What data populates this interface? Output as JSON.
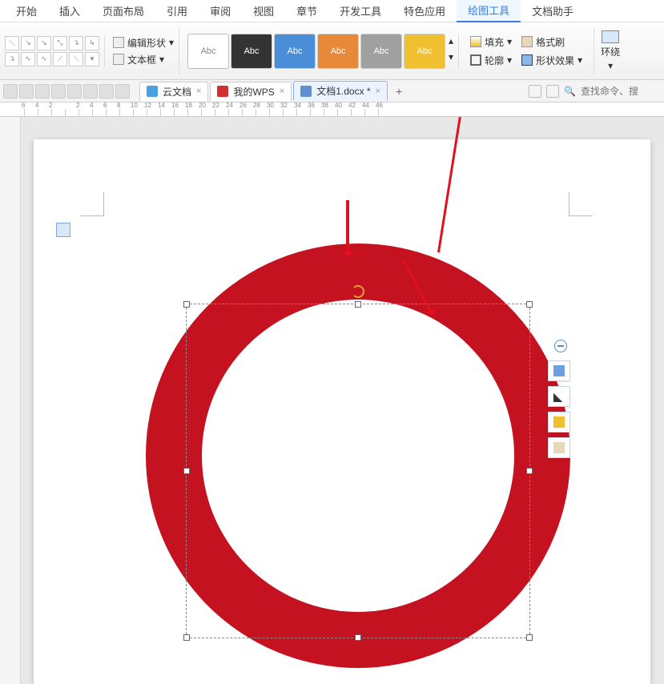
{
  "menu": {
    "items": [
      "开始",
      "插入",
      "页面布局",
      "引用",
      "审阅",
      "视图",
      "章节",
      "开发工具",
      "特色应用",
      "绘图工具",
      "文档助手"
    ],
    "active_index": 9
  },
  "ribbon": {
    "edit_shape": "编辑形状",
    "textbox": "文本框",
    "style_label": "Abc",
    "fill": "填充",
    "format_brush": "格式刷",
    "outline": "轮廓",
    "shape_effect": "形状效果",
    "wrap": "环绕"
  },
  "tabs": {
    "cloud": "云文档",
    "mywps": "我的WPS",
    "doc": "文档1.docx *"
  },
  "search_placeholder": "查找命令、搜",
  "ruler_numbers": [
    "6",
    "4",
    "2",
    "",
    "2",
    "4",
    "6",
    "8",
    "10",
    "12",
    "14",
    "16",
    "18",
    "20",
    "22",
    "24",
    "26",
    "28",
    "30",
    "32",
    "34",
    "36",
    "38",
    "40",
    "42",
    "44",
    "46"
  ],
  "colors": {
    "ring": "#c41220",
    "accent": "#3a7ed8"
  }
}
